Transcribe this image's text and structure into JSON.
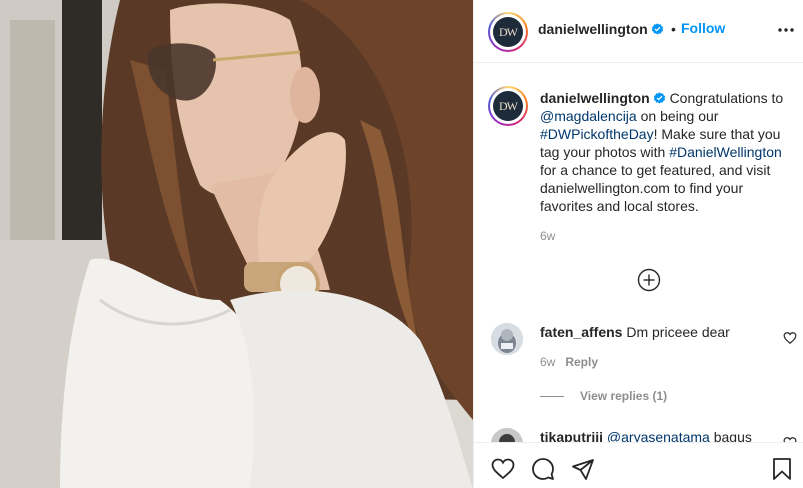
{
  "post": {
    "username": "danielwellington",
    "avatar_text": "DW",
    "follow_label": "Follow",
    "separator": "•",
    "icons": {
      "verified": "verified-badge-icon",
      "more": "more-options-icon",
      "load_more": "plus-circle-icon",
      "like": "heart-icon",
      "comment": "comment-icon",
      "share": "share-icon",
      "save": "bookmark-icon"
    },
    "caption": {
      "part1": "Congratulations to",
      "mention": "@magdalencija",
      "part2": "on being our",
      "hashtag1": "#DWPickoftheDay",
      "part3": "! Make sure that you tag your photos with",
      "hashtag2": "#DanielWellington",
      "part4": "for a chance to get featured, and visit danielwellington.com to find your favorites and local stores.",
      "time": "6w"
    }
  },
  "comments": [
    {
      "username": "faten_affens",
      "text": "Dm priceee dear",
      "time": "6w",
      "reply_label": "Reply",
      "view_replies": "View replies (1)"
    },
    {
      "username": "tikaputriii",
      "mention": "@aryasenatama",
      "text": "bagus"
    }
  ],
  "colors": {
    "link": "#0095f6",
    "hashtag": "#00376b",
    "muted": "#8e8e8e",
    "text": "#262626"
  }
}
